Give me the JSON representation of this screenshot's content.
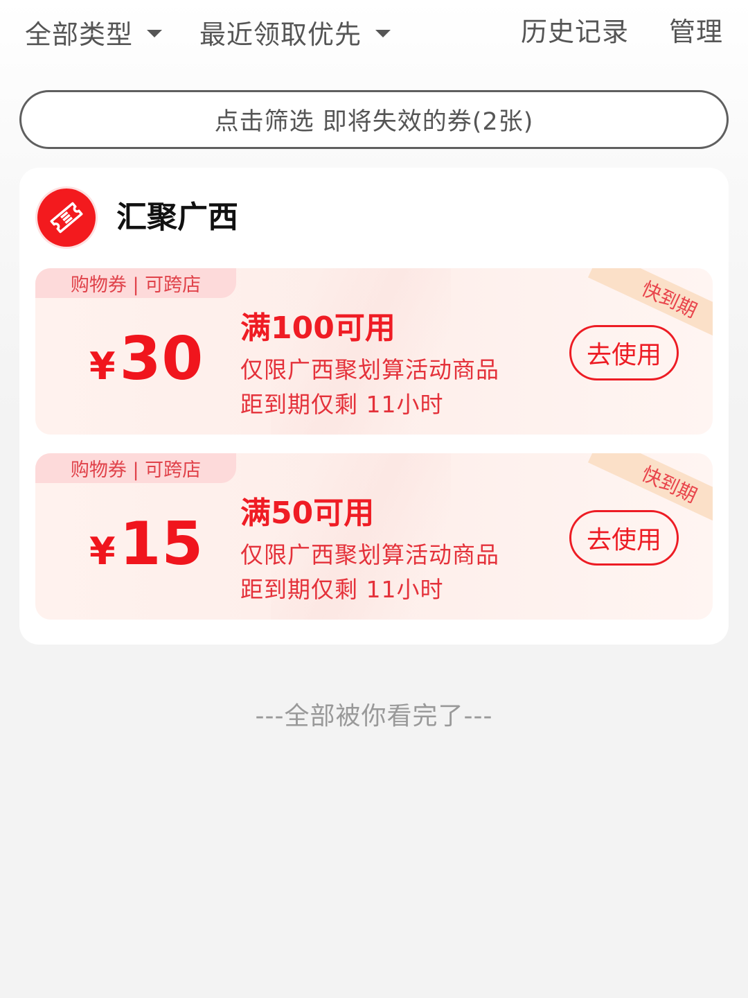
{
  "topbar": {
    "type_filter": "全部类型",
    "sort_filter": "最近领取优先",
    "history": "历史记录",
    "manage": "管理"
  },
  "filter_pill": {
    "label": "点击筛选 即将失效的券(2张)"
  },
  "store": {
    "name": "汇聚广西",
    "logo_icon": "ticket-icon",
    "brand_color": "#f31a1e"
  },
  "coupons": [
    {
      "tag": "购物券 | 可跨店",
      "currency": "¥",
      "amount": "30",
      "condition": "满100可用",
      "scope": "仅限广西聚划算活动商品",
      "expire": "距到期仅剩 11小时",
      "button": "去使用",
      "ribbon": "快到期"
    },
    {
      "tag": "购物券 | 可跨店",
      "currency": "¥",
      "amount": "15",
      "condition": "满50可用",
      "scope": "仅限广西聚划算活动商品",
      "expire": "距到期仅剩 11小时",
      "button": "去使用",
      "ribbon": "快到期"
    }
  ],
  "footer": {
    "end_text": "---全部被你看完了---"
  },
  "colors": {
    "accent": "#ed1c24",
    "coupon_bg": "#fdeeea",
    "tag_bg": "#fddada",
    "ribbon_bg": "#fbe0c8"
  }
}
